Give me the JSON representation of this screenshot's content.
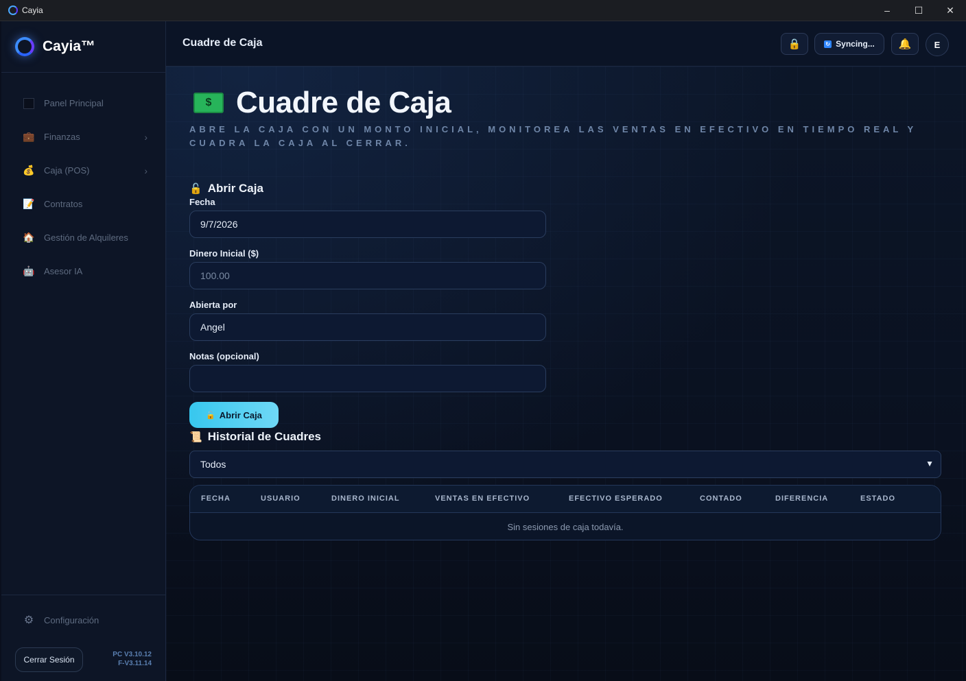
{
  "window": {
    "title": "Cayia"
  },
  "sidebar": {
    "brand": "Cayia™",
    "items": [
      {
        "label": "Panel Principal",
        "icon": "square-icon",
        "chevron": false
      },
      {
        "label": "Finanzas",
        "icon": "briefcase-icon",
        "chevron": true
      },
      {
        "label": "Caja (POS)",
        "icon": "money-bag-icon",
        "chevron": true
      },
      {
        "label": "Contratos",
        "icon": "document-icon",
        "chevron": false
      },
      {
        "label": "Gestión de Alquileres",
        "icon": "house-icon",
        "chevron": false
      },
      {
        "label": "Asesor IA",
        "icon": "robot-icon",
        "chevron": false
      }
    ],
    "config_label": "Configuración",
    "logout_label": "Cerrar Sesión",
    "version_pc": "PC V3.10.12",
    "version_f": "F-V3.11.14"
  },
  "header": {
    "title": "Cuadre de Caja",
    "sync_label": "Syncing...",
    "avatar_letter": "E"
  },
  "page": {
    "title": "Cuadre de Caja",
    "subtitle": "Abre la caja con un monto inicial, monitorea las ventas en efectivo en tiempo real y cuadra la caja al cerrar."
  },
  "open_form": {
    "section_title": "Abrir Caja",
    "date_label": "Fecha",
    "date_value": "9/7/2026",
    "initial_label": "Dinero Inicial ($)",
    "initial_placeholder": "100.00",
    "opened_by_label": "Abierta por",
    "opened_by_value": "Angel",
    "notes_label": "Notas (opcional)",
    "notes_value": "",
    "submit_label": "Abrir Caja"
  },
  "history": {
    "section_title": "Historial de Cuadres",
    "filter_selected": "Todos",
    "columns": [
      "FECHA",
      "USUARIO",
      "DINERO INICIAL",
      "VENTAS EN EFECTIVO",
      "EFECTIVO ESPERADO",
      "CONTADO",
      "DIFERENCIA",
      "ESTADO"
    ],
    "empty_message": "Sin sesiones de caja todavía."
  },
  "colors": {
    "accent": "#37c7ee",
    "background": "#0a0f1d",
    "sidebar": "#0d1526"
  }
}
